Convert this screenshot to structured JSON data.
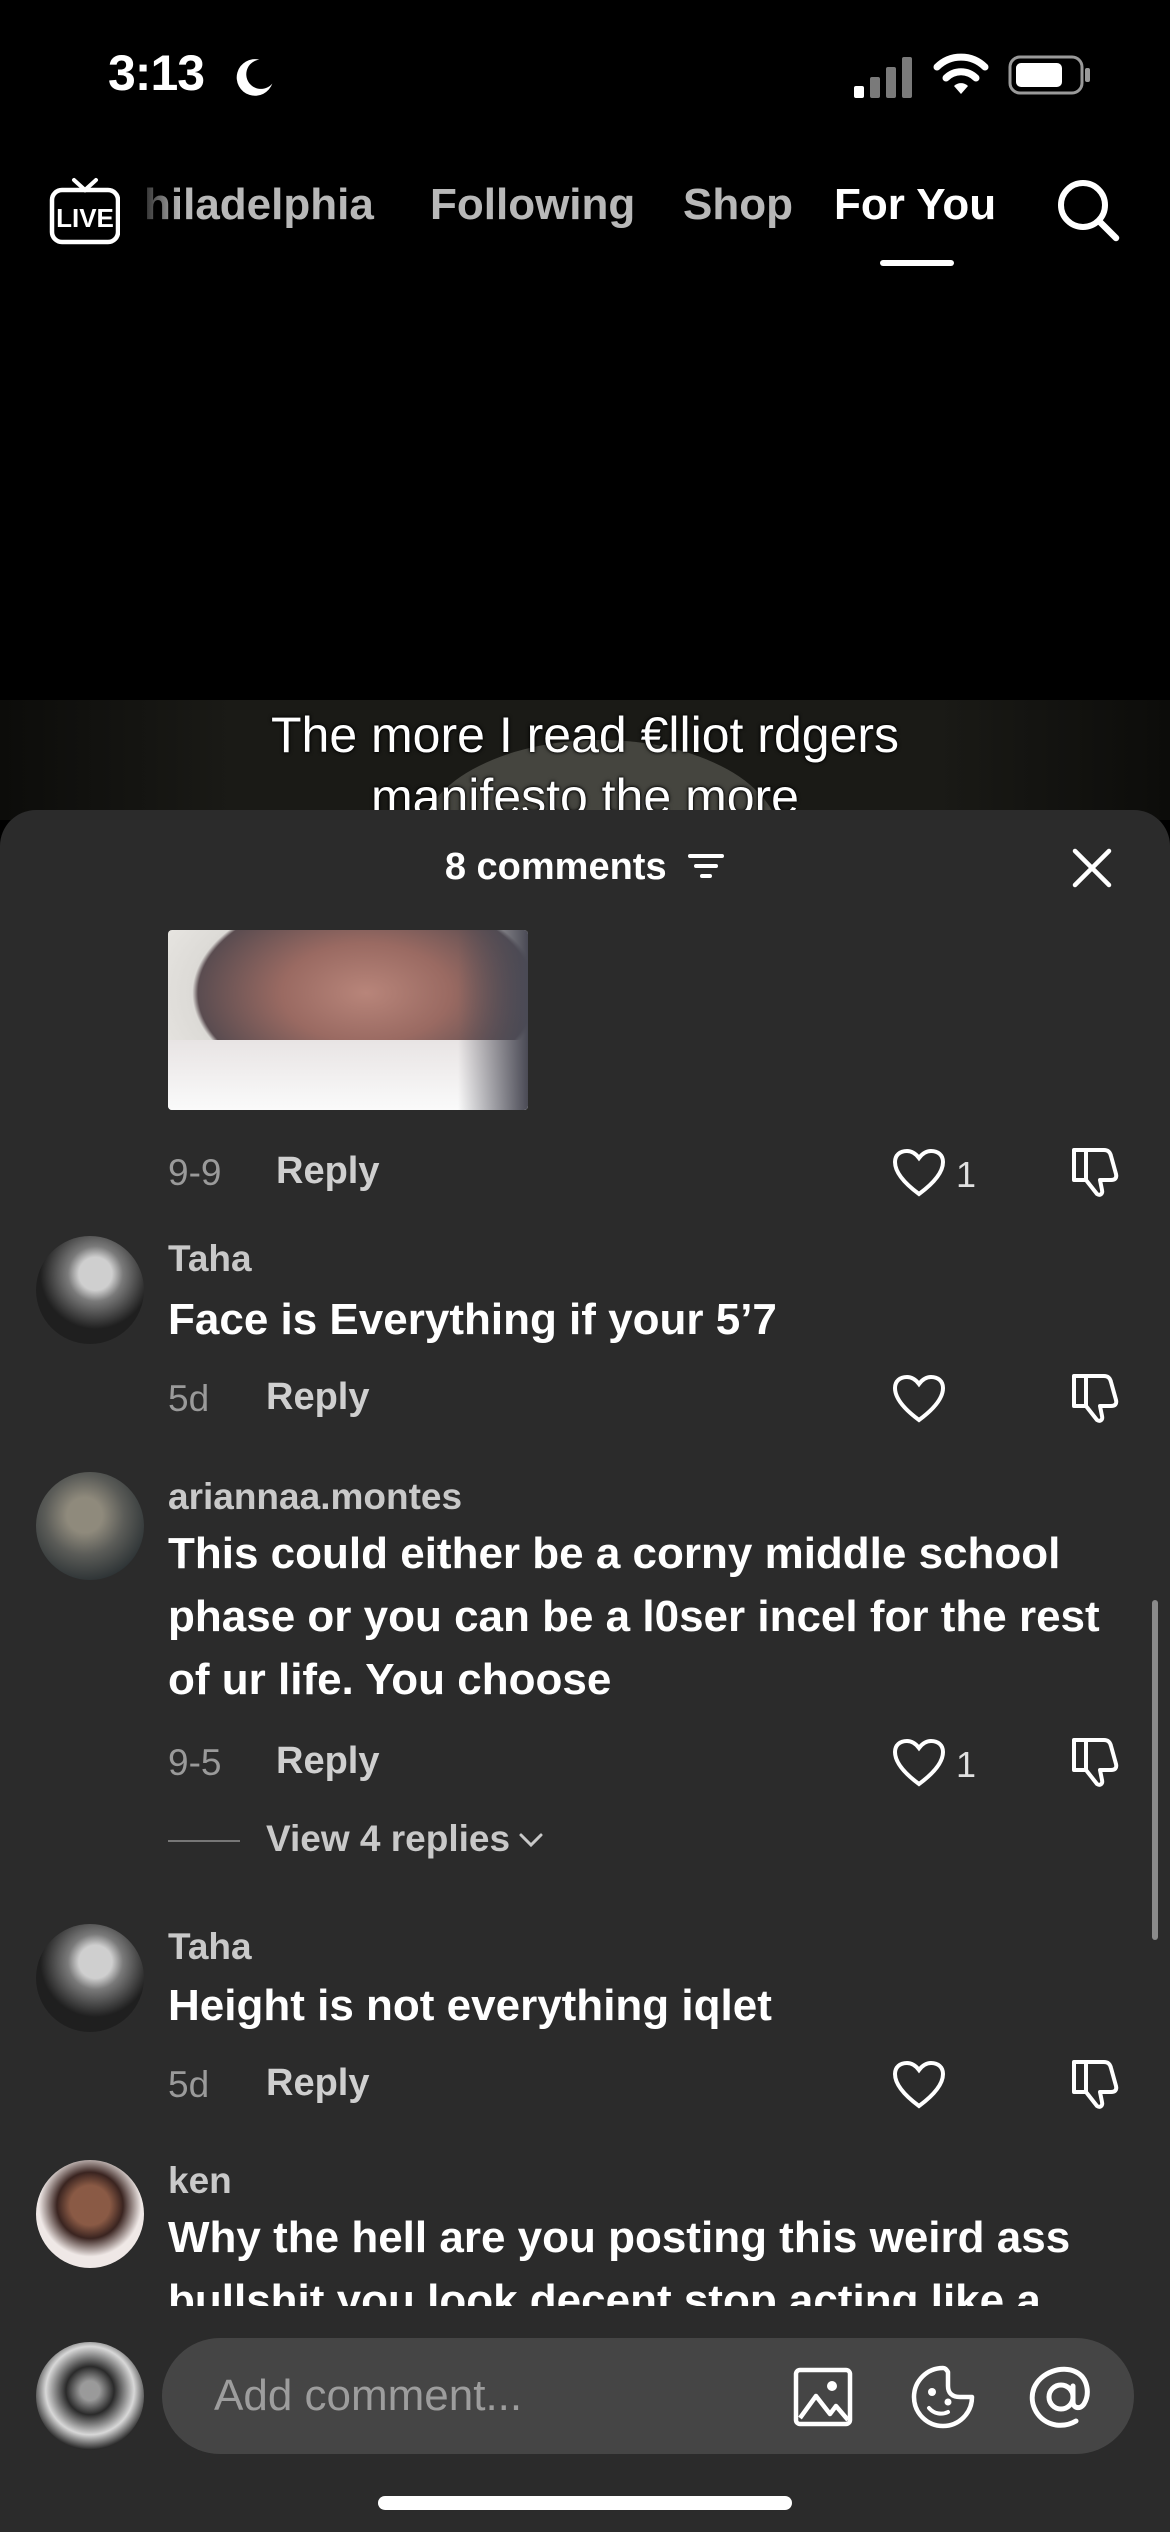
{
  "status_bar": {
    "time": "3:13",
    "icons": [
      "moon-icon",
      "signal-icon",
      "wifi-icon",
      "battery-icon"
    ]
  },
  "top_nav": {
    "live_icon": "LIVE",
    "tabs": [
      {
        "label": "hiladelphia"
      },
      {
        "label": "Following"
      },
      {
        "label": "Shop"
      },
      {
        "label": "For You"
      }
    ],
    "active_tab": "For You",
    "search_icon": "search-icon"
  },
  "video": {
    "caption": "The more I read €lliot rdgers manifesto the more"
  },
  "comments_sheet": {
    "title": "8 comments",
    "comments": [
      {
        "username": "",
        "text": "",
        "date": "9-9",
        "reply": "Reply",
        "likes": "1"
      },
      {
        "username": "Taha",
        "text": "Face is Everything if your 5’7",
        "date": "5d",
        "reply": "Reply",
        "likes": ""
      },
      {
        "username": "ariannaa.montes",
        "text": "This could either be a corny middle school phase or you can be a l0ser incel for the rest of ur life. You choose",
        "date": "9-5",
        "reply": "Reply",
        "likes": "1",
        "view_replies": "View 4 replies"
      },
      {
        "username": "Taha",
        "text": "Height is not everything iqlet",
        "date": "5d",
        "reply": "Reply",
        "likes": ""
      },
      {
        "username": "ken",
        "text": "Why the hell are you posting this weird ass bullshit you look decent stop acting like a",
        "date": "",
        "reply": "",
        "likes": ""
      }
    ]
  },
  "input": {
    "placeholder": "Add comment..."
  },
  "colors": {
    "sheet_bg": "#2b2b2b",
    "input_bg": "#454545",
    "background": "#000000"
  }
}
